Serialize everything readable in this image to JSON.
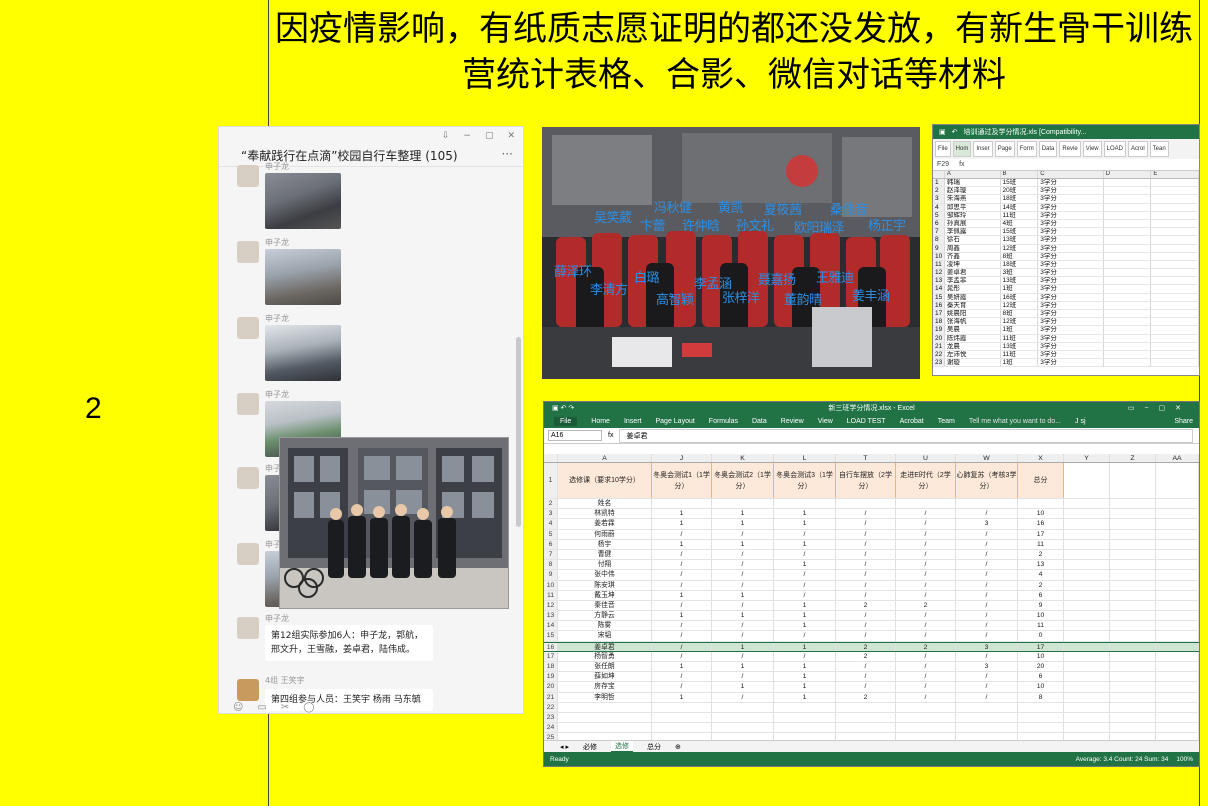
{
  "row_number": "2",
  "headline": "因疫情影响，有纸质志愿证明的都还没发放，有新生骨干训练营统计表格、合影、微信对话等材料",
  "chat": {
    "title": "“奉献践行在点滴”校园自行车整理 (105)",
    "more": "···",
    "sender": "申子龙",
    "sender2": "4组 王笑宇",
    "message1": "第12组实际参加6人：申子龙，郭航，邢文升，王雪融，姜卓君，陆伟成。",
    "message2": "第四组参与人员：王笑宇 杨雨 马东毓"
  },
  "group_photo": {
    "names": [
      "吴笑葳",
      "冯秋健",
      "黄凯",
      "夏筱茜",
      "桑佳音",
      "卞蕾",
      "许仲晗",
      "孙文礼",
      "欧阳瑞泽",
      "杨正宇",
      "薛泽环",
      "白璐",
      "李清方",
      "高智颖",
      "李孟涵",
      "聂嘉扬",
      "王雅迪",
      "张梓洋",
      "董韵晴",
      "姜丰涵"
    ]
  },
  "excel_small": {
    "title": "培训通过及学分情况.xls [Compatibility...",
    "tabs": [
      "File",
      "Hom",
      "Inser",
      "Page",
      "Form",
      "Data",
      "Revie",
      "View",
      "LOAD",
      "Acrol",
      "Tean"
    ],
    "cell_ref": "F29",
    "col_headers": [
      "",
      "A",
      "B",
      "C",
      "D",
      "E"
    ],
    "rows": [
      [
        "1",
        "韩瑞",
        "15班",
        "3学分"
      ],
      [
        "2",
        "赵泽璇",
        "20班",
        "3学分"
      ],
      [
        "3",
        "朱海燕",
        "18班",
        "3学分"
      ],
      [
        "4",
        "邱思平",
        "14班",
        "3学分"
      ],
      [
        "5",
        "邹辉玲",
        "11班",
        "3学分"
      ],
      [
        "6",
        "孙真展",
        "4班",
        "3学分"
      ],
      [
        "7",
        "李佩露",
        "15班",
        "3学分"
      ],
      [
        "8",
        "徐石",
        "13班",
        "3学分"
      ],
      [
        "9",
        "周鑫",
        "12班",
        "3学分"
      ],
      [
        "10",
        "齐鑫",
        "8班",
        "3学分"
      ],
      [
        "11",
        "凌坤",
        "18班",
        "3学分"
      ],
      [
        "12",
        "姜卓君",
        "3班",
        "3学分"
      ],
      [
        "13",
        "李孟菲",
        "13班",
        "3学分"
      ],
      [
        "14",
        "晁彤",
        "1班",
        "3学分"
      ],
      [
        "15",
        "吴妍霞",
        "16班",
        "3学分"
      ],
      [
        "16",
        "秦天育",
        "12班",
        "3学分"
      ],
      [
        "17",
        "姚晨阳",
        "8班",
        "3学分"
      ],
      [
        "18",
        "张海帆",
        "12班",
        "3学分"
      ],
      [
        "19",
        "吴晨",
        "1班",
        "3学分"
      ],
      [
        "20",
        "陈炜霞",
        "11班",
        "3学分"
      ],
      [
        "21",
        "龙晨",
        "13班",
        "3学分"
      ],
      [
        "22",
        "左沛悦",
        "11班",
        "3学分"
      ],
      [
        "23",
        "谢璇",
        "1班",
        "3学分"
      ]
    ]
  },
  "excel_big": {
    "title": "新三班学分情况.xlsx - Excel",
    "menu": [
      "File",
      "Home",
      "Insert",
      "Page Layout",
      "Formulas",
      "Data",
      "Review",
      "View",
      "LOAD TEST",
      "Acrobat",
      "Team"
    ],
    "tell": "Tell me what you want to do...",
    "user": "J sj",
    "share": "Share",
    "cell_ref": "A16",
    "formula_value": "姜卓君",
    "col_letters": [
      "",
      "A",
      "J",
      "K",
      "L",
      "T",
      "U",
      "W",
      "X",
      "Y",
      "Z",
      "AA"
    ],
    "header_row": [
      "1",
      "选修课（要求10学分）",
      "冬奥会测试1（1学分）",
      "冬奥会测试2（1学分）",
      "冬奥会测试3（1学分）",
      "自行车摆放（2学分）",
      "走进E时代（2学分）",
      "心肺复苏（考核3学分）",
      "总分",
      "",
      "",
      ""
    ],
    "rows": [
      [
        "2",
        "姓名",
        "",
        "",
        "",
        "",
        "",
        "",
        "",
        "",
        "",
        ""
      ],
      [
        "3",
        "林凯特",
        "1",
        "1",
        "1",
        "/",
        "/",
        "/",
        "10",
        "",
        "",
        ""
      ],
      [
        "4",
        "姜若霖",
        "1",
        "1",
        "1",
        "/",
        "/",
        "3",
        "16",
        "",
        "",
        ""
      ],
      [
        "5",
        "何雨蔚",
        "/",
        "/",
        "/",
        "/",
        "/",
        "/",
        "17",
        "",
        "",
        ""
      ],
      [
        "6",
        "杨宇",
        "1",
        "1",
        "1",
        "/",
        "/",
        "/",
        "11",
        "",
        "",
        ""
      ],
      [
        "7",
        "曹健",
        "/",
        "/",
        "/",
        "/",
        "/",
        "/",
        "2",
        "",
        "",
        ""
      ],
      [
        "8",
        "付翔",
        "/",
        "/",
        "1",
        "/",
        "/",
        "/",
        "13",
        "",
        "",
        ""
      ],
      [
        "9",
        "张中伟",
        "/",
        "/",
        "/",
        "/",
        "/",
        "/",
        "4",
        "",
        "",
        ""
      ],
      [
        "10",
        "陈安琪",
        "/",
        "/",
        "/",
        "/",
        "/",
        "/",
        "2",
        "",
        "",
        ""
      ],
      [
        "11",
        "戴玉坤",
        "1",
        "1",
        "/",
        "/",
        "/",
        "/",
        "6",
        "",
        "",
        ""
      ],
      [
        "12",
        "秦佳音",
        "/",
        "/",
        "1",
        "2",
        "2",
        "/",
        "9",
        "",
        "",
        ""
      ],
      [
        "13",
        "方静云",
        "1",
        "1",
        "1",
        "/",
        "/",
        "/",
        "10",
        "",
        "",
        ""
      ],
      [
        "14",
        "陈雾",
        "/",
        "/",
        "1",
        "/",
        "/",
        "/",
        "11",
        "",
        "",
        ""
      ],
      [
        "15",
        "宋韬",
        "/",
        "/",
        "/",
        "/",
        "/",
        "/",
        "0",
        "",
        "",
        ""
      ],
      [
        "16",
        "姜卓君",
        "/",
        "1",
        "1",
        "2",
        "2",
        "3",
        "17",
        "",
        "",
        ""
      ],
      [
        "17",
        "杨智勇",
        "/",
        "/",
        "/",
        "2",
        "/",
        "/",
        "10",
        "",
        "",
        ""
      ],
      [
        "18",
        "张任朗",
        "1",
        "1",
        "1",
        "/",
        "/",
        "3",
        "20",
        "",
        "",
        ""
      ],
      [
        "19",
        "薛如坤",
        "/",
        "/",
        "1",
        "/",
        "/",
        "/",
        "6",
        "",
        "",
        ""
      ],
      [
        "20",
        "房存宝",
        "/",
        "1",
        "1",
        "/",
        "/",
        "/",
        "10",
        "",
        "",
        ""
      ],
      [
        "21",
        "李明哲",
        "1",
        "/",
        "1",
        "2",
        "/",
        "/",
        "8",
        "",
        "",
        ""
      ],
      [
        "22",
        "",
        "",
        "",
        "",
        "",
        "",
        "",
        "",
        "",
        "",
        ""
      ],
      [
        "23",
        "",
        "",
        "",
        "",
        "",
        "",
        "",
        "",
        "",
        "",
        ""
      ],
      [
        "24",
        "",
        "",
        "",
        "",
        "",
        "",
        "",
        "",
        "",
        "",
        ""
      ],
      [
        "25",
        "",
        "",
        "",
        "",
        "",
        "",
        "",
        "",
        "",
        "",
        ""
      ],
      [
        "26",
        "",
        "",
        "",
        "",
        "",
        "",
        "",
        "",
        "",
        "",
        ""
      ]
    ],
    "sheet_tabs": [
      "必修",
      "选修",
      "总分"
    ],
    "status": "Ready",
    "status_stats": "Average: 3.4    Count: 24    Sum: 34",
    "zoom": "100%"
  }
}
